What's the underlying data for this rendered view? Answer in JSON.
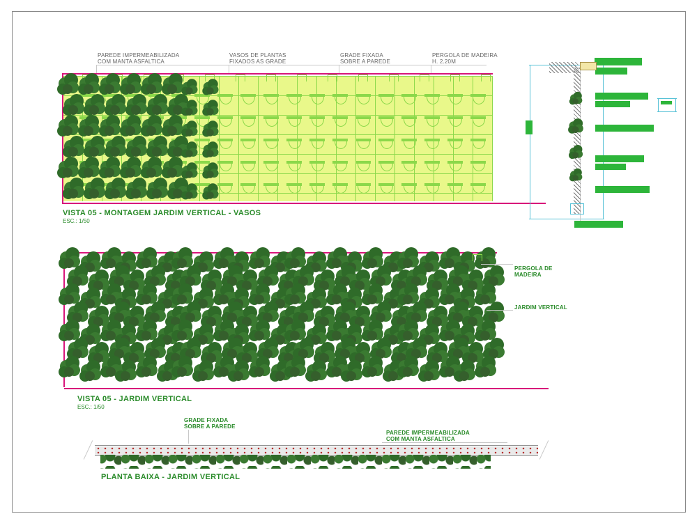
{
  "view1": {
    "callout_parede": {
      "l1": "PAREDE IMPERMEABILIZADA",
      "l2": "COM MANTA ASFALTICA"
    },
    "callout_vasos": {
      "l1": "VASOS DE PLANTAS",
      "l2": "FIXADOS AS GRADE"
    },
    "callout_grade": {
      "l1": "GRADE FIXADA",
      "l2": "SOBRE A PAREDE"
    },
    "callout_pergola": {
      "l1": "PERGOLA DE MADEIRA",
      "l2": "H. 2.20M"
    },
    "title": "VISTA 05 - MONTAGEM JARDIM VERTICAL - VASOS",
    "scale": "ESC.: 1/50"
  },
  "view2": {
    "callout_pergola": {
      "l1": "PERGOLA DE",
      "l2": "MADEIRA"
    },
    "callout_jardim": "JARDIM VERTICAL",
    "title": "VISTA 05 -  JARDIM VERTICAL",
    "scale": "ESC.: 1/50"
  },
  "plan": {
    "callout_grade": {
      "l1": "GRADE FIXADA",
      "l2": "SOBRE A PAREDE"
    },
    "callout_parede": {
      "l1": "PAREDE IMPERMEABILIZADA",
      "l2": "COM MANTA ASFALTICA"
    },
    "title": "PLANTA BAIXA - JARDIM VERTICAL"
  }
}
